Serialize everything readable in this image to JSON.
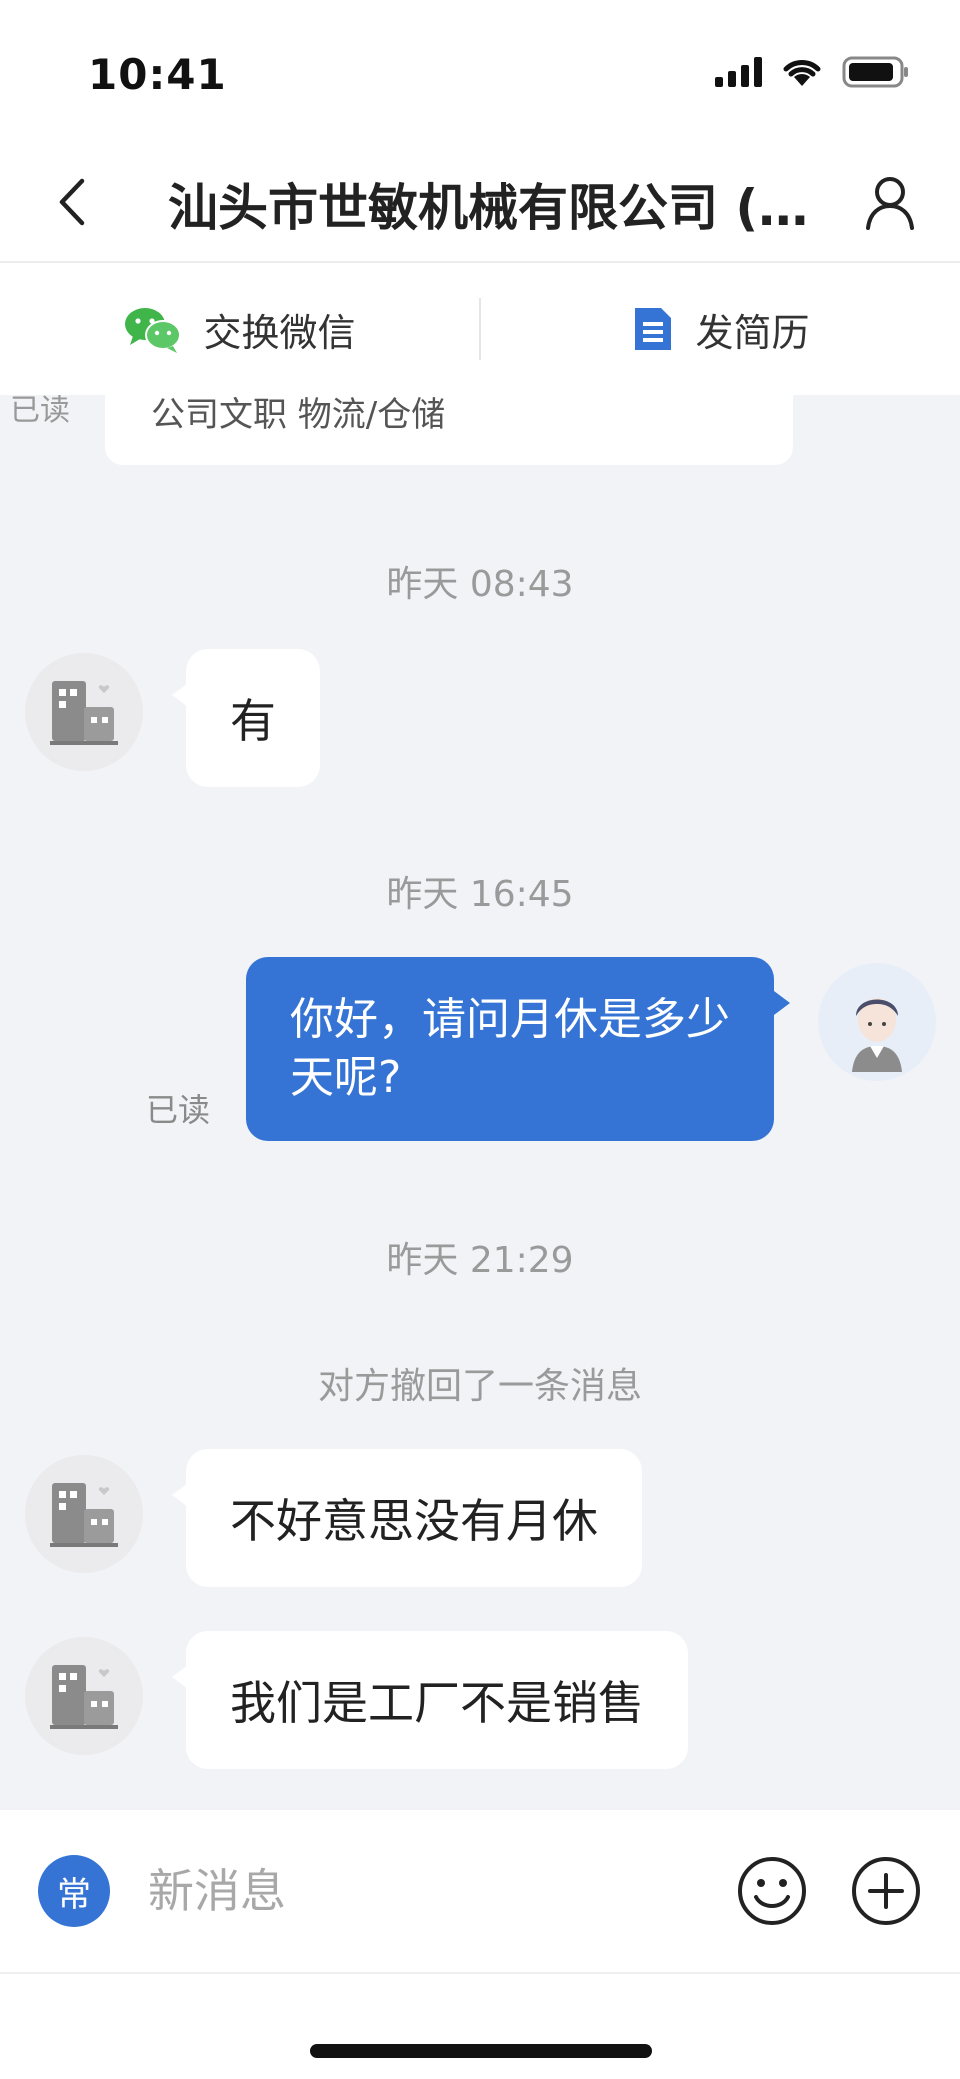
{
  "status_bar": {
    "time": "10:41"
  },
  "header": {
    "title": "汕头市世敏机械有限公司 (…"
  },
  "actions": {
    "wechat_label": "交换微信",
    "resume_label": "发简历"
  },
  "chat": {
    "partial_card": {
      "text": "公司文职 物流/仓储",
      "read": "已读"
    },
    "messages": [
      {
        "timestamp": "昨天 08:43",
        "text": "有"
      },
      {
        "timestamp": "昨天 16:45",
        "text": "你好，请问月休是多少天呢?",
        "read": "已读"
      },
      {
        "timestamp": "昨天 21:29"
      },
      {
        "system": "对方撤回了一条消息"
      },
      {
        "text": "不好意思没有月休"
      },
      {
        "text": "我们是工厂不是销售"
      }
    ]
  },
  "input": {
    "quick_label": "常",
    "placeholder": "新消息"
  },
  "colors": {
    "accent": "#3574d4",
    "wechat": "#3fb54a",
    "background": "#f2f3f7"
  }
}
